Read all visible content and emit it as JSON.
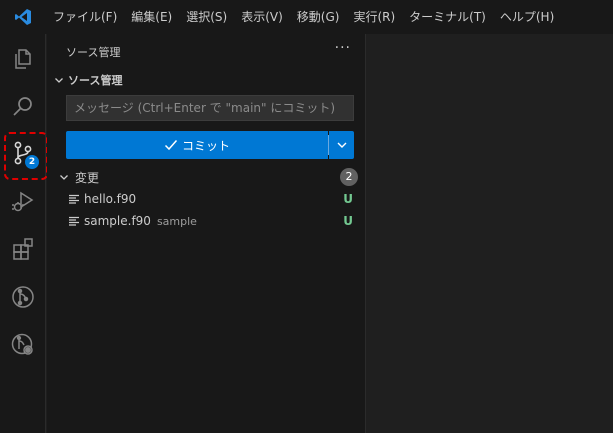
{
  "colors": {
    "accent": "#0078d4",
    "scm_badge": "#0078d4",
    "untracked_status": "#73c991",
    "highlight_border": "#e00000"
  },
  "menu": {
    "items": [
      "ファイル(F)",
      "編集(E)",
      "選択(S)",
      "表示(V)",
      "移動(G)",
      "実行(R)",
      "ターミナル(T)",
      "ヘルプ(H)"
    ]
  },
  "activity_bar": {
    "icons": [
      "explorer-icon",
      "search-icon",
      "source-control-icon",
      "run-debug-icon",
      "extensions-icon",
      "git-graph-icon",
      "git-history-icon"
    ],
    "scm_badge": "2"
  },
  "sidebar": {
    "title": "ソース管理",
    "more": "···",
    "section_title": "ソース管理",
    "commit_placeholder": "メッセージ (Ctrl+Enter で \"main\" にコミット)",
    "commit_label": "コミット",
    "changes_label": "変更",
    "changes_count": "2",
    "files": [
      {
        "name": "hello.f90",
        "desc": "",
        "status": "U"
      },
      {
        "name": "sample.f90",
        "desc": "sample",
        "status": "U"
      }
    ]
  }
}
